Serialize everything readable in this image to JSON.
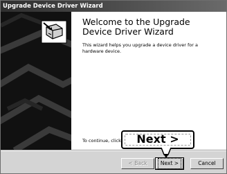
{
  "window": {
    "title": "Upgrade Device Driver Wizard"
  },
  "content": {
    "heading": "Welcome to the Upgrade Device Driver Wizard",
    "description": "This wizard helps you upgrade a device driver for a hardware device.",
    "continue_text": "To continue, click"
  },
  "buttons": {
    "back_label": "< Back",
    "next_label": "Next >",
    "cancel_label": "Cancel"
  },
  "callout": {
    "label": "Next >"
  },
  "icons": {
    "wizard": "hardware-wizard-icon",
    "callout_pointer": "callout-pointer-arrow"
  },
  "colors": {
    "titlebar": "#2e2e2e",
    "sidebar": "#111111",
    "button_face": "#d4d4d4"
  }
}
